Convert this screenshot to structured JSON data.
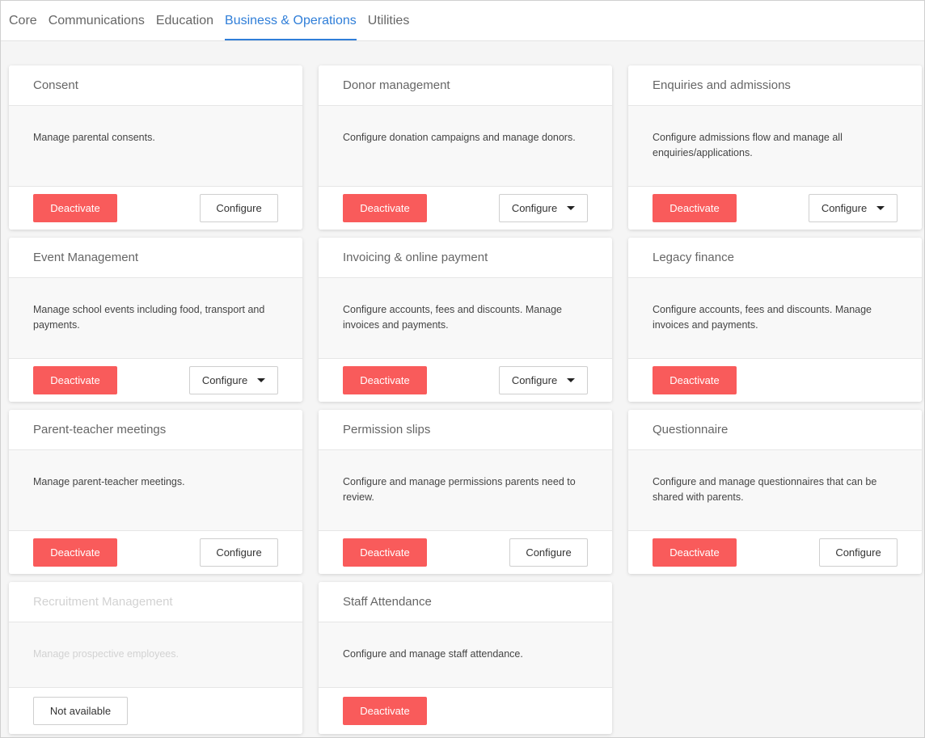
{
  "tabs": [
    {
      "label": "Core"
    },
    {
      "label": "Communications"
    },
    {
      "label": "Education"
    },
    {
      "label": "Business & Operations",
      "active": true
    },
    {
      "label": "Utilities"
    }
  ],
  "buttons": {
    "deactivate": "Deactivate",
    "configure": "Configure",
    "not_available": "Not available"
  },
  "colors": {
    "accent": "#2f7ed8",
    "deactivate": "#f95b5b"
  },
  "cards": [
    {
      "title": "Consent",
      "description": "Manage parental consents.",
      "configure": "plain"
    },
    {
      "title": "Donor management",
      "description": "Configure donation campaigns and manage donors.",
      "configure": "dropdown"
    },
    {
      "title": "Enquiries and admissions",
      "description": "Configure admissions flow and manage all enquiries/applications.",
      "configure": "dropdown"
    },
    {
      "title": "Event Management",
      "description": "Manage school events including food, transport and payments.",
      "configure": "dropdown"
    },
    {
      "title": "Invoicing & online payment",
      "description": "Configure accounts, fees and discounts. Manage invoices and payments.",
      "configure": "dropdown"
    },
    {
      "title": "Legacy finance",
      "description": "Configure accounts, fees and discounts. Manage invoices and payments.",
      "configure": "none"
    },
    {
      "title": "Parent-teacher meetings",
      "description": "Manage parent-teacher meetings.",
      "configure": "plain"
    },
    {
      "title": "Permission slips",
      "description": "Configure and manage permissions parents need to review.",
      "configure": "plain"
    },
    {
      "title": "Questionnaire",
      "description": "Configure and manage questionnaires that can be shared with parents.",
      "configure": "plain"
    },
    {
      "title": "Recruitment Management",
      "description": "Manage prospective employees.",
      "configure": "none",
      "available": false
    },
    {
      "title": "Staff Attendance",
      "description": "Configure and manage staff attendance.",
      "configure": "none"
    }
  ]
}
